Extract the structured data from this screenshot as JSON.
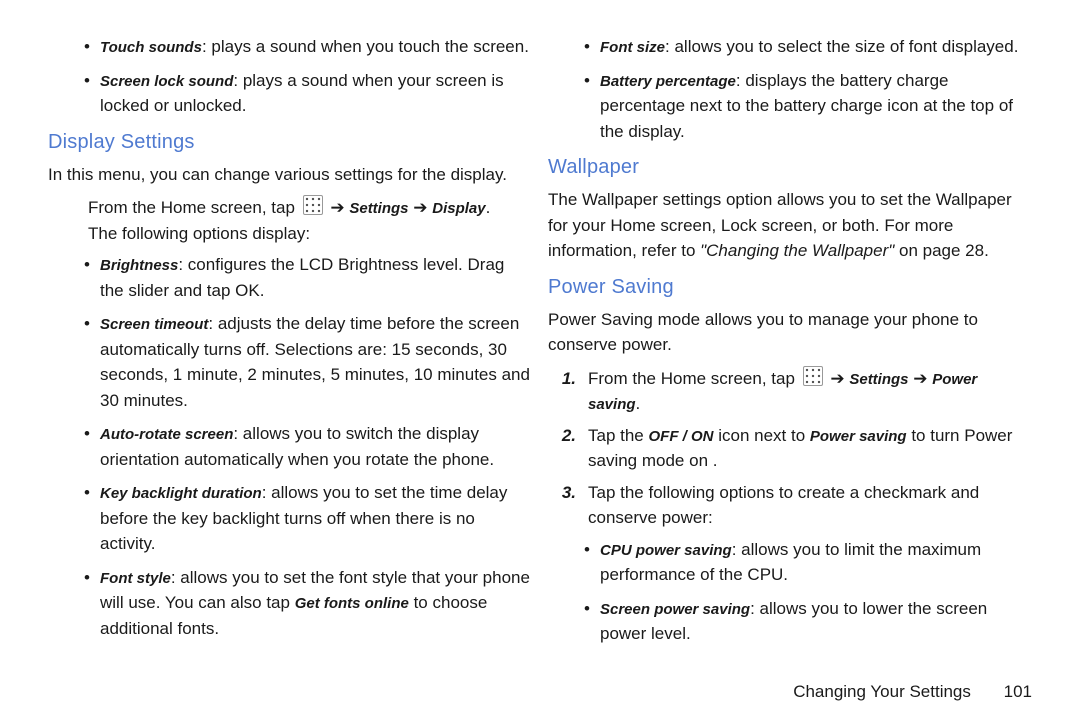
{
  "left": {
    "bullets_intro": [
      {
        "label": "Touch sounds",
        "desc": ": plays a sound when you touch the screen."
      },
      {
        "label": "Screen lock sound",
        "desc": ": plays a sound when your screen is locked or unlocked."
      }
    ],
    "heading": "Display Settings",
    "intro": "In this menu, you can change various settings for the display.",
    "step_prefix": "From the Home screen, tap ",
    "step_settings": "Settings",
    "step_arrow": " ➔ ",
    "step_display": "Display",
    "step_period": ".",
    "step_followup": "The following options display:",
    "options": [
      {
        "label": "Brightness",
        "desc": ": configures the LCD Brightness level. Drag the slider and tap OK."
      },
      {
        "label": "Screen timeout",
        "desc": ": adjusts the delay time before the screen automatically turns off. Selections are: 15 seconds, 30 seconds, 1 minute, 2 minutes, 5 minutes, 10 minutes and 30 minutes."
      },
      {
        "label": "Auto-rotate screen",
        "desc": ": allows you to switch the display orientation automatically when you rotate the phone."
      },
      {
        "label": "Key backlight duration",
        "desc": ": allows you to set the time delay before the key backlight turns off when there is no activity."
      },
      {
        "label": "Font style",
        "desc_a": ": allows you to set the font style that your phone will use. You can also tap ",
        "get_fonts": "Get fonts online",
        "desc_b": " to choose additional fonts."
      }
    ]
  },
  "right": {
    "bullets_intro": [
      {
        "label": "Font size",
        "desc": ": allows you to select the size of font displayed."
      },
      {
        "label": "Battery percentage",
        "desc": ": displays the battery charge percentage next to the battery charge icon at the top of the display."
      }
    ],
    "wallpaper_heading": "Wallpaper",
    "wallpaper_text_a": "The Wallpaper settings option allows you to set the Wallpaper for your Home screen, Lock screen, or both. For more information, refer to ",
    "wallpaper_link": "\"Changing the Wallpaper\"",
    "wallpaper_text_b": " on page 28.",
    "power_heading": "Power Saving",
    "power_intro": "Power Saving mode allows you to manage your phone to conserve power.",
    "steps": {
      "s1_prefix": "From the Home screen, tap ",
      "s1_settings": "Settings",
      "s1_arrow": " ➔ ",
      "s1_power": "Power saving",
      "s1_period": ".",
      "s2_a": "Tap the ",
      "s2_offon": "OFF / ON",
      "s2_b": " icon next to ",
      "s2_ps": "Power saving",
      "s2_c": " to turn Power saving mode on ",
      "s2_d": ".",
      "s3": "Tap the following options to create a checkmark and conserve power:"
    },
    "power_options": [
      {
        "label": "CPU power saving",
        "desc": ": allows you to limit the maximum performance of the CPU."
      },
      {
        "label": "Screen power saving",
        "desc": ": allows you to lower the screen power level."
      }
    ]
  },
  "footer": {
    "section": "Changing Your Settings",
    "page": "101"
  }
}
